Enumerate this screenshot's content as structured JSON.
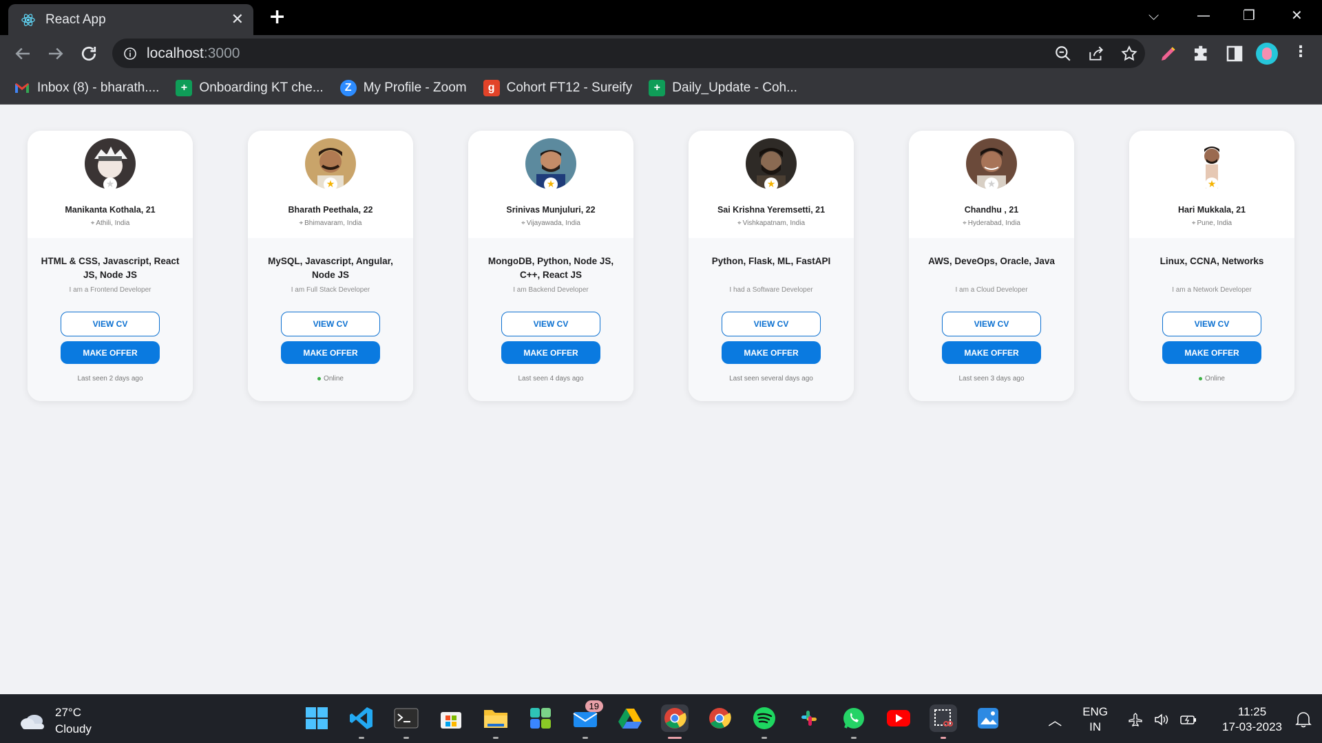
{
  "browser": {
    "tab_title": "React App",
    "url_host": "localhost",
    "url_port": ":3000",
    "bookmarks": [
      {
        "label": "Inbox (8) - bharath....",
        "icon": "gmail-icon",
        "color": "#ea4335"
      },
      {
        "label": "Onboarding KT che...",
        "icon": "sheets-icon",
        "color": "#0f9d58"
      },
      {
        "label": "My Profile - Zoom",
        "icon": "zoom-icon",
        "color": "#2d8cff"
      },
      {
        "label": "Cohort FT12 - Sureify",
        "icon": "gitlab-icon",
        "color": "#e24329"
      },
      {
        "label": "Daily_Update - Coh...",
        "icon": "sheets-icon",
        "color": "#0f9d58"
      }
    ]
  },
  "cards": [
    {
      "name": "Manikanta Kothala, 21",
      "location": "Athili, India",
      "skills": "HTML & CSS, Javascript, React JS, Node JS",
      "role": "I am a Frontend Developer",
      "view_cv": "VIEW CV",
      "make_offer": "MAKE OFFER",
      "status": "Last seen 2 days ago",
      "online": false,
      "starred": false
    },
    {
      "name": "Bharath Peethala, 22",
      "location": "Bhimavaram, India",
      "skills": "MySQL, Javascript, Angular, Node JS",
      "role": "I am Full Stack Developer",
      "view_cv": "VIEW CV",
      "make_offer": "MAKE OFFER",
      "status": "Online",
      "online": true,
      "starred": true
    },
    {
      "name": "Srinivas Munjuluri, 22",
      "location": "Vijayawada, India",
      "skills": "MongoDB, Python, Node JS, C++, React JS",
      "role": "I am Backend Developer",
      "view_cv": "VIEW CV",
      "make_offer": "MAKE OFFER",
      "status": "Last seen 4 days ago",
      "online": false,
      "starred": true
    },
    {
      "name": "Sai Krishna Yeremsetti, 21",
      "location": "Vishkapatnam, India",
      "skills": "Python, Flask, ML, FastAPI",
      "role": "I had a Software Developer",
      "view_cv": "VIEW CV",
      "make_offer": "MAKE OFFER",
      "status": "Last seen several days ago",
      "online": false,
      "starred": true
    },
    {
      "name": "Chandhu , 21",
      "location": "Hyderabad, India",
      "skills": "AWS, DeveOps, Oracle, Java",
      "role": "I am a Cloud Developer",
      "view_cv": "VIEW CV",
      "make_offer": "MAKE OFFER",
      "status": "Last seen 3 days ago",
      "online": false,
      "starred": false
    },
    {
      "name": "Hari Mukkala, 21",
      "location": "Pune, India",
      "skills": "Linux, CCNA, Networks",
      "role": "I am a Network Developer",
      "view_cv": "VIEW CV",
      "make_offer": "MAKE OFFER",
      "status": "Online",
      "online": true,
      "starred": true
    }
  ],
  "taskbar": {
    "temperature": "27°C",
    "weather": "Cloudy",
    "mail_badge": "19",
    "language": "ENG",
    "region": "IN",
    "time": "11:25",
    "date": "17-03-2023"
  },
  "colors": {
    "primary": "#0a7ae0",
    "online": "#3cb043",
    "star_active": "#f5b301",
    "star_inactive": "#d0d0d0"
  }
}
